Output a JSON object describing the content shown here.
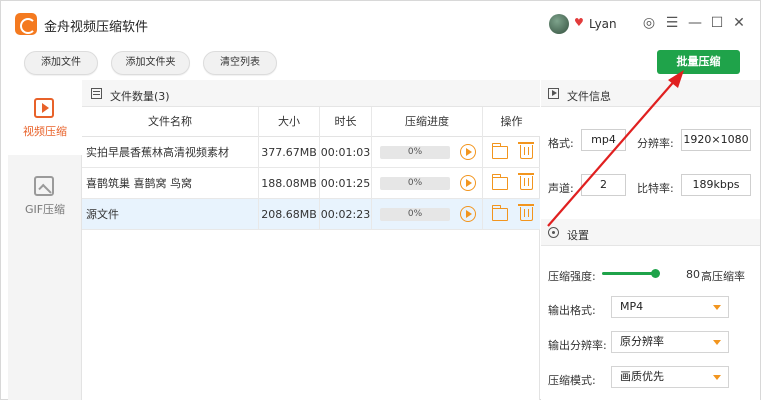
{
  "app": {
    "title": "金舟视频压缩软件",
    "username": "Lyan"
  },
  "window_controls": {
    "skin": "◎",
    "menu": "☰",
    "minimize": "—",
    "maximize": "☐",
    "close": "✕"
  },
  "toolbar": {
    "add_file": "添加文件",
    "add_folder": "添加文件夹",
    "clear_list": "清空列表",
    "batch_compress": "批量压缩"
  },
  "sidebar": {
    "items": [
      {
        "label": "视频压缩",
        "icon": "video-icon"
      },
      {
        "label": "GIF压缩",
        "icon": "image-icon"
      }
    ]
  },
  "file_panel": {
    "title": "文件数量(3)",
    "columns": [
      "文件名称",
      "大小",
      "时长",
      "压缩进度",
      "操作"
    ],
    "rows": [
      {
        "name": "实拍早晨香蕉林高清视频素材",
        "size": "377.67MB",
        "duration": "00:01:03",
        "progress": "0%"
      },
      {
        "name": "喜鹊筑巢 喜鹊窝 鸟窝",
        "size": "188.08MB",
        "duration": "00:01:25",
        "progress": "0%"
      },
      {
        "name": "源文件",
        "size": "208.68MB",
        "duration": "00:02:23",
        "progress": "0%"
      }
    ]
  },
  "file_info": {
    "title": "文件信息",
    "format_label": "格式:",
    "format_value": "mp4",
    "resolution_label": "分辨率:",
    "resolution_value": "1920×1080",
    "channels_label": "声道:",
    "channels_value": "2",
    "bitrate_label": "比特率:",
    "bitrate_value": "189kbps"
  },
  "settings": {
    "title": "设置",
    "strength_label": "压缩强度:",
    "strength_value": "80",
    "strength_suffix": "高压缩率",
    "output_format_label": "输出格式:",
    "output_format_value": "MP4",
    "output_resolution_label": "输出分辨率:",
    "output_resolution_value": "原分辨率",
    "mode_label": "压缩模式:",
    "mode_value": "画质优先"
  },
  "colors": {
    "accent_green": "#1fa34a",
    "accent_orange": "#f2951e",
    "annotation_red": "#e02020"
  }
}
